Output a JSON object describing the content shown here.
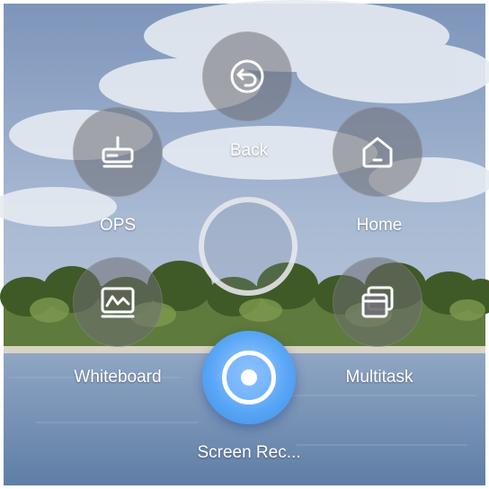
{
  "menu": {
    "back_label": "Back",
    "home_label": "Home",
    "ops_label": "OPS",
    "whiteboard_label": "Whiteboard",
    "multitask_label": "Multitask",
    "screen_record_label": "Screen Rec..."
  },
  "icons": {
    "back": "back-arrow-icon",
    "home": "home-icon",
    "ops": "ops-router-icon",
    "whiteboard": "whiteboard-icon",
    "multitask": "multitask-windows-icon",
    "screen_record": "record-icon"
  },
  "colors": {
    "accent": "#4f9cf0",
    "button_bg": "#6e6e73"
  }
}
